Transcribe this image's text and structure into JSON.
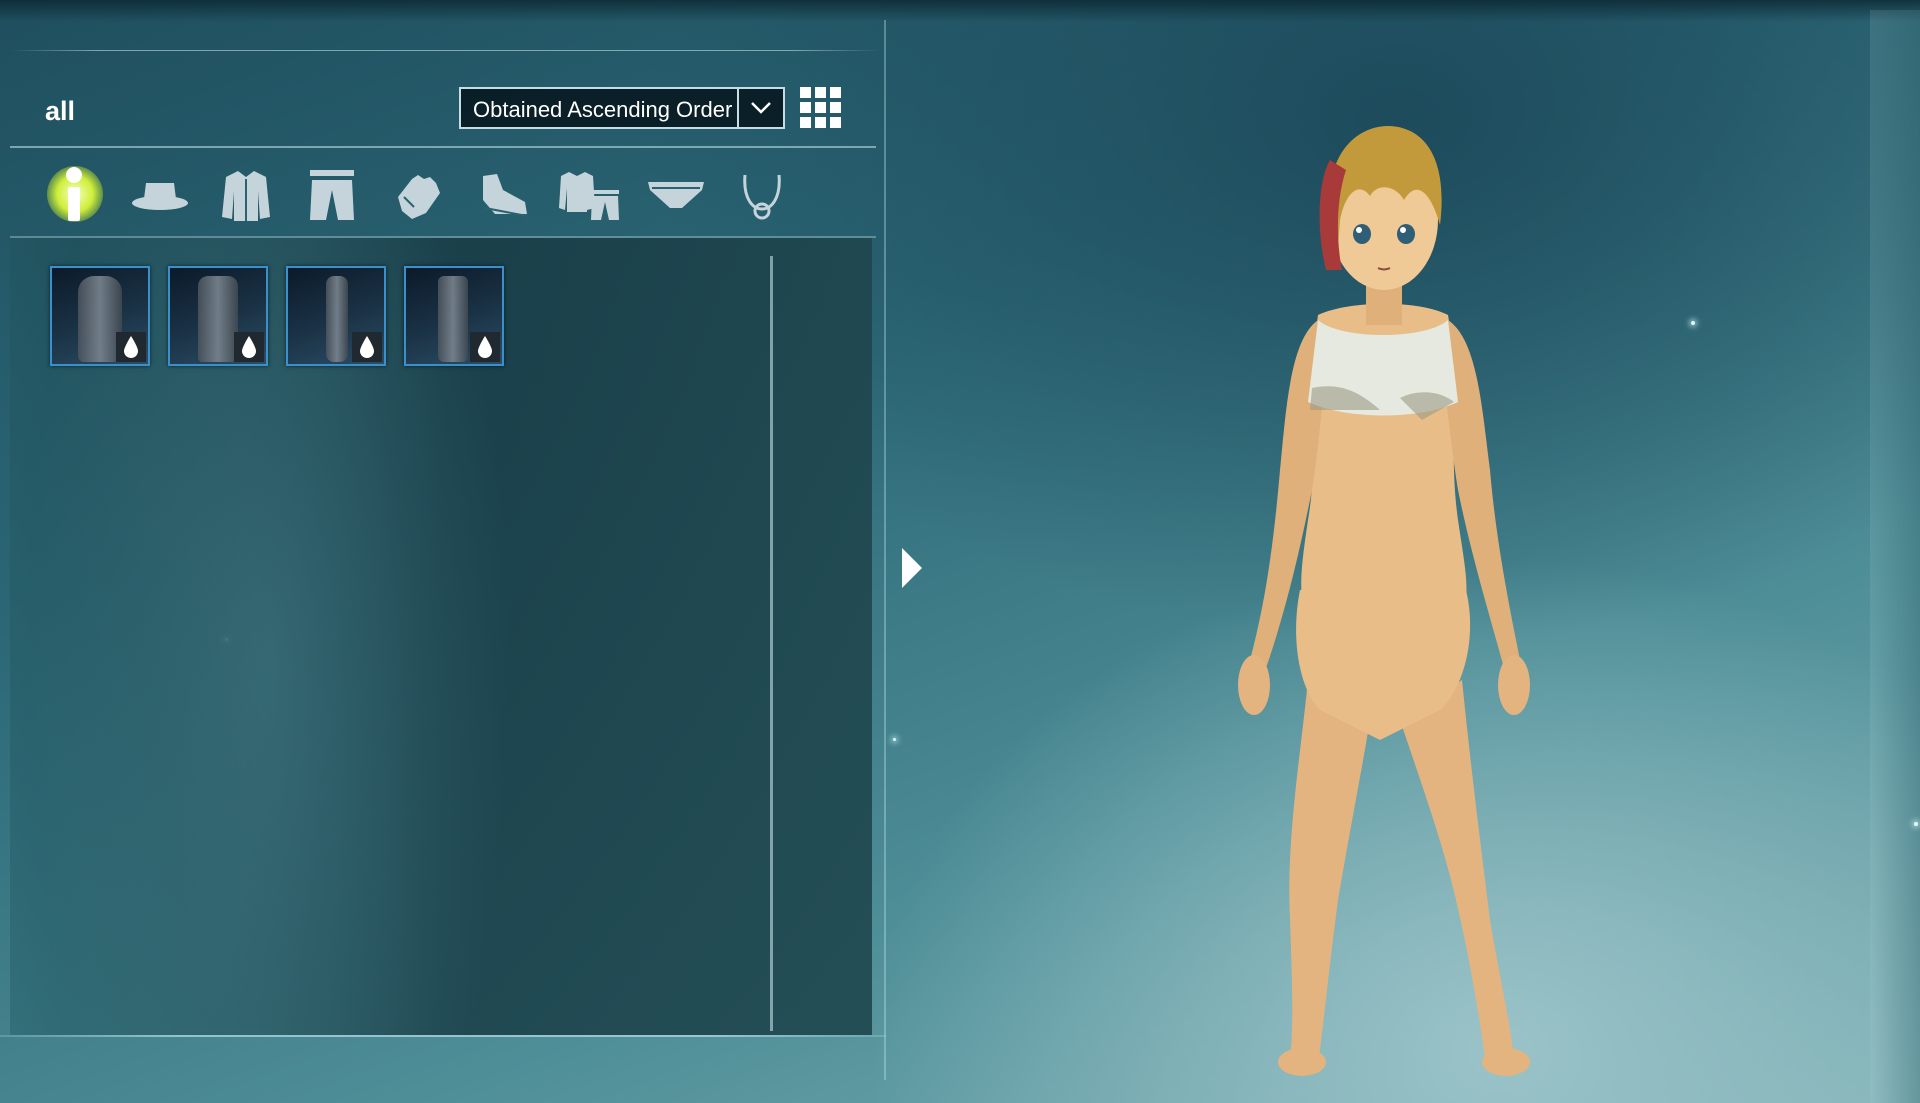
{
  "header": {
    "filter_title": "all",
    "sort": {
      "selected": "Obtained Ascending Order"
    },
    "view_toggle_icon": "grid-view-icon"
  },
  "categories": [
    {
      "name": "all",
      "icon": "all-person-icon",
      "active": true
    },
    {
      "name": "hat",
      "icon": "hat-icon",
      "active": false
    },
    {
      "name": "top",
      "icon": "jacket-icon",
      "active": false
    },
    {
      "name": "bottom",
      "icon": "pants-icon",
      "active": false
    },
    {
      "name": "gloves",
      "icon": "glove-icon",
      "active": false
    },
    {
      "name": "shoes",
      "icon": "shoe-icon",
      "active": false
    },
    {
      "name": "set",
      "icon": "outfit-set-icon",
      "active": false
    },
    {
      "name": "underwear",
      "icon": "underwear-icon",
      "active": false
    },
    {
      "name": "accessory",
      "icon": "necklace-icon",
      "active": false
    }
  ],
  "items": [
    {
      "kind": "top",
      "badge_icon": "drop-icon"
    },
    {
      "kind": "bottom",
      "badge_icon": "drop-icon"
    },
    {
      "kind": "gloves",
      "badge_icon": "drop-icon"
    },
    {
      "kind": "boots",
      "badge_icon": "drop-icon"
    }
  ],
  "colors": {
    "active_category": "#cfee3a",
    "icon": "#c4d4da",
    "item_border": "#3a8fcd"
  }
}
